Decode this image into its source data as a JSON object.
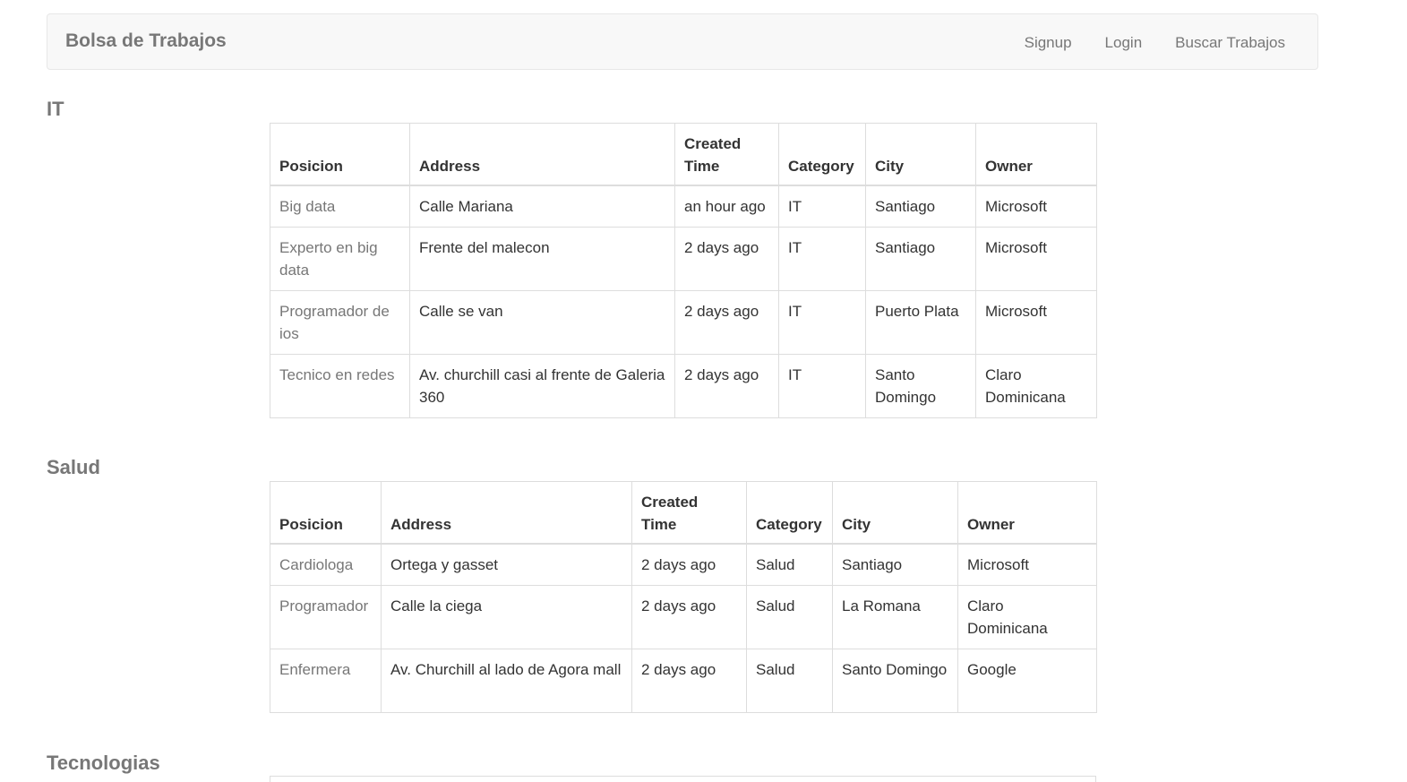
{
  "navbar": {
    "brand": "Bolsa de Trabajos",
    "links": [
      "Signup",
      "Login",
      "Buscar Trabajos"
    ]
  },
  "headers": [
    "Posicion",
    "Address",
    "Created Time",
    "Category",
    "City",
    "Owner"
  ],
  "sections": [
    {
      "title": "IT",
      "rows": [
        [
          "Big data",
          "Calle Mariana",
          "an hour ago",
          "IT",
          "Santiago",
          "Microsoft"
        ],
        [
          "Experto en big data",
          "Frente del malecon",
          "2 days ago",
          "IT",
          "Santiago",
          "Microsoft"
        ],
        [
          "Programador de ios",
          "Calle se van",
          "2 days ago",
          "IT",
          "Puerto Plata",
          "Microsoft"
        ],
        [
          "Tecnico en redes",
          "Av. churchill casi al frente de Galeria 360",
          "2 days ago",
          "IT",
          "Santo Domingo",
          "Claro Dominicana"
        ]
      ]
    },
    {
      "title": "Salud",
      "rows": [
        [
          "Cardiologa",
          "Ortega y gasset",
          "2 days ago",
          "Salud",
          "Santiago",
          "Microsoft"
        ],
        [
          "Programador",
          "Calle la ciega",
          "2 days ago",
          "Salud",
          "La Romana",
          "Claro Dominicana"
        ],
        [
          "Enfermera",
          "Av. Churchill al lado de Agora mall",
          "2 days ago",
          "Salud",
          "Santo Domingo",
          "Google"
        ]
      ]
    },
    {
      "title": "Tecnologias",
      "rows": []
    }
  ]
}
